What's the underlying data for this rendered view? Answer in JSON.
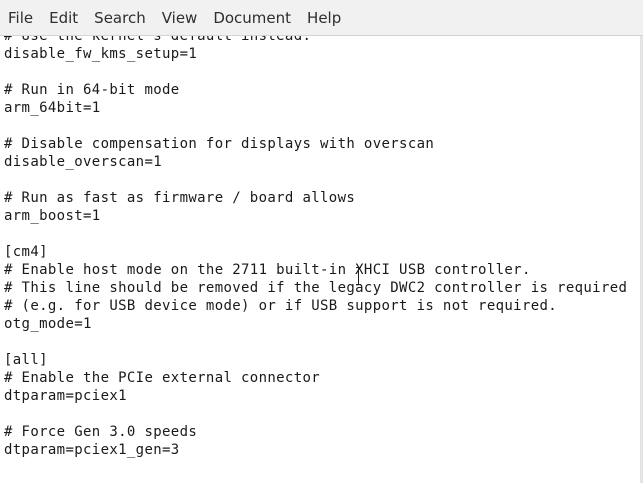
{
  "menu": {
    "items": [
      "File",
      "Edit",
      "Search",
      "View",
      "Document",
      "Help"
    ]
  },
  "editor": {
    "lines": [
      "# Use the kernel's default instead.",
      "disable_fw_kms_setup=1",
      "",
      "# Run in 64-bit mode",
      "arm_64bit=1",
      "",
      "# Disable compensation for displays with overscan",
      "disable_overscan=1",
      "",
      "# Run as fast as firmware / board allows",
      "arm_boost=1",
      "",
      "[cm4]",
      "# Enable host mode on the 2711 built-in XHCI USB controller.",
      "# This line should be removed if the legacy DWC2 controller is required",
      "# (e.g. for USB device mode) or if USB support is not required.",
      "otg_mode=1",
      "",
      "[all]",
      "# Enable the PCIe external connector",
      "dtparam=pciex1",
      "",
      "# Force Gen 3.0 speeds",
      "dtparam=pciex1_gen=3"
    ]
  }
}
